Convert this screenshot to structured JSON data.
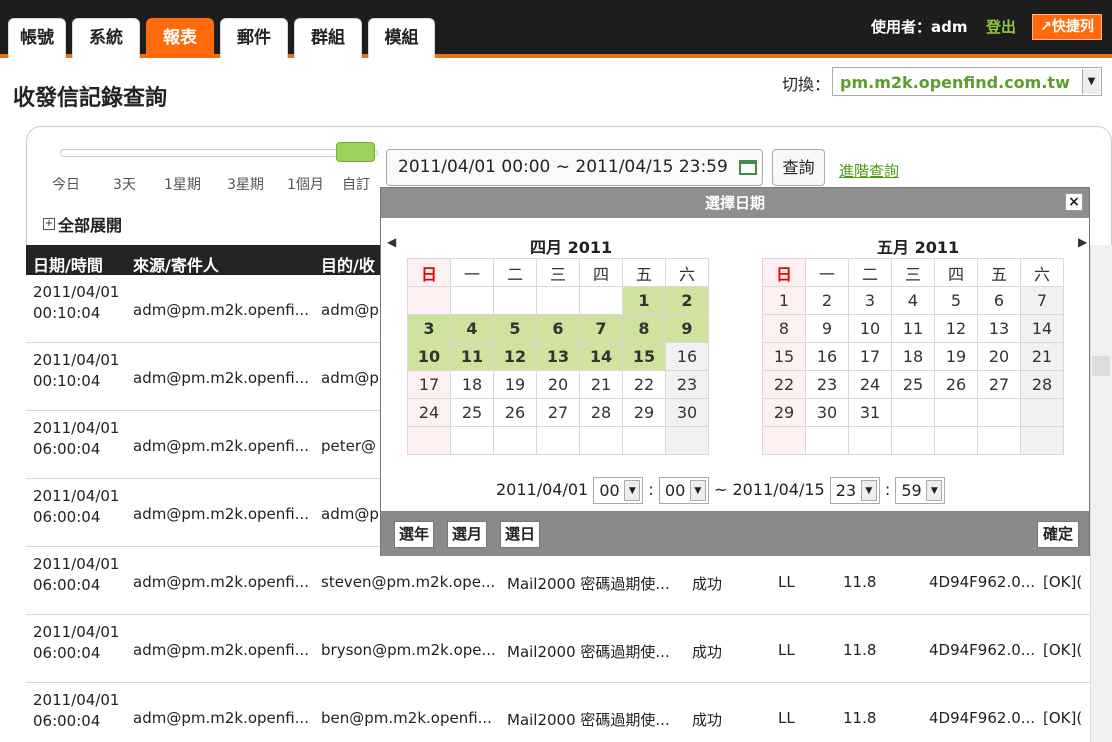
{
  "tabs": [
    {
      "label": "帳號"
    },
    {
      "label": "系統"
    },
    {
      "label": "報表"
    },
    {
      "label": "郵件"
    },
    {
      "label": "群組"
    },
    {
      "label": "模組"
    }
  ],
  "user": {
    "label": "使用者：adm",
    "logout": "登出",
    "shortcut": "快捷列"
  },
  "page": {
    "title": "收發信記錄查詢"
  },
  "switcher": {
    "label": "切換：",
    "value": "pm.m2k.openfind.com.tw"
  },
  "range": {
    "labels": [
      "今日",
      "3天",
      "1星期",
      "3星期",
      "1個月",
      "自訂"
    ],
    "value": "2011/04/01 00:00 ~ 2011/04/15 23:59"
  },
  "buttons": {
    "query": "查詢",
    "advanced": "進階查詢",
    "expand_all": "全部展開"
  },
  "table": {
    "headers": [
      "日期/時間",
      "來源/寄件人",
      "目的/收"
    ],
    "rows": [
      {
        "date": "2011/04/01",
        "time": "00:10:04",
        "from": "adm@pm.m2k.openfi...",
        "to": "adm@p",
        "subject": "",
        "status": "",
        "mode": "",
        "size": "",
        "id": "",
        "result": ""
      },
      {
        "date": "2011/04/01",
        "time": "00:10:04",
        "from": "adm@pm.m2k.openfi...",
        "to": "adm@p",
        "subject": "",
        "status": "",
        "mode": "",
        "size": "",
        "id": "",
        "result": ""
      },
      {
        "date": "2011/04/01",
        "time": "06:00:04",
        "from": "adm@pm.m2k.openfi...",
        "to": "peter@",
        "subject": "",
        "status": "",
        "mode": "",
        "size": "",
        "id": "",
        "result": ""
      },
      {
        "date": "2011/04/01",
        "time": "06:00:04",
        "from": "adm@pm.m2k.openfi...",
        "to": "adm@p",
        "subject": "",
        "status": "",
        "mode": "",
        "size": "",
        "id": "",
        "result": ""
      },
      {
        "date": "2011/04/01",
        "time": "06:00:04",
        "from": "adm@pm.m2k.openfi...",
        "to": "steven@pm.m2k.ope...",
        "subject": "Mail2000 密碼過期使...",
        "status": "成功",
        "mode": "LL",
        "size": "11.8",
        "id": "4D94F962.0...",
        "result": "[OK]("
      },
      {
        "date": "2011/04/01",
        "time": "06:00:04",
        "from": "adm@pm.m2k.openfi...",
        "to": "bryson@pm.m2k.ope...",
        "subject": "Mail2000 密碼過期使...",
        "status": "成功",
        "mode": "LL",
        "size": "11.8",
        "id": "4D94F962.0...",
        "result": "[OK]("
      },
      {
        "date": "2011/04/01",
        "time": "06:00:04",
        "from": "adm@pm.m2k.openfi...",
        "to": "ben@pm.m2k.openfi...",
        "subject": "Mail2000 密碼過期使...",
        "status": "成功",
        "mode": "LL",
        "size": "11.8",
        "id": "4D94F962.0...",
        "result": "[OK]("
      }
    ]
  },
  "calendar": {
    "title": "選擇日期",
    "weekdays": [
      "日",
      "一",
      "二",
      "三",
      "四",
      "五",
      "六"
    ],
    "months": [
      {
        "title": "四月 2011",
        "weeks": [
          [
            "",
            "",
            "",
            "",
            "",
            "1",
            "2"
          ],
          [
            "3",
            "4",
            "5",
            "6",
            "7",
            "8",
            "9"
          ],
          [
            "10",
            "11",
            "12",
            "13",
            "14",
            "15",
            "16"
          ],
          [
            "17",
            "18",
            "19",
            "20",
            "21",
            "22",
            "23"
          ],
          [
            "24",
            "25",
            "26",
            "27",
            "28",
            "29",
            "30"
          ],
          [
            "",
            "",
            "",
            "",
            "",
            "",
            ""
          ]
        ]
      },
      {
        "title": "五月 2011",
        "weeks": [
          [
            "1",
            "2",
            "3",
            "4",
            "5",
            "6",
            "7"
          ],
          [
            "8",
            "9",
            "10",
            "11",
            "12",
            "13",
            "14"
          ],
          [
            "15",
            "16",
            "17",
            "18",
            "19",
            "20",
            "21"
          ],
          [
            "22",
            "23",
            "24",
            "25",
            "26",
            "27",
            "28"
          ],
          [
            "29",
            "30",
            "31",
            "",
            "",
            "",
            ""
          ],
          [
            "",
            "",
            "",
            "",
            "",
            "",
            ""
          ]
        ]
      }
    ],
    "time": {
      "start_date": "2011/04/01",
      "start_hour": "00",
      "start_minute": "00",
      "separator": "~",
      "end_date": "2011/04/15",
      "end_hour": "23",
      "end_minute": "59"
    },
    "buttons": {
      "year": "選年",
      "month": "選月",
      "day": "選日",
      "ok": "確定"
    }
  },
  "colors": {
    "accent": "#ff6b0a",
    "selected_day": "#cfe29e",
    "link": "#4d9a19"
  }
}
